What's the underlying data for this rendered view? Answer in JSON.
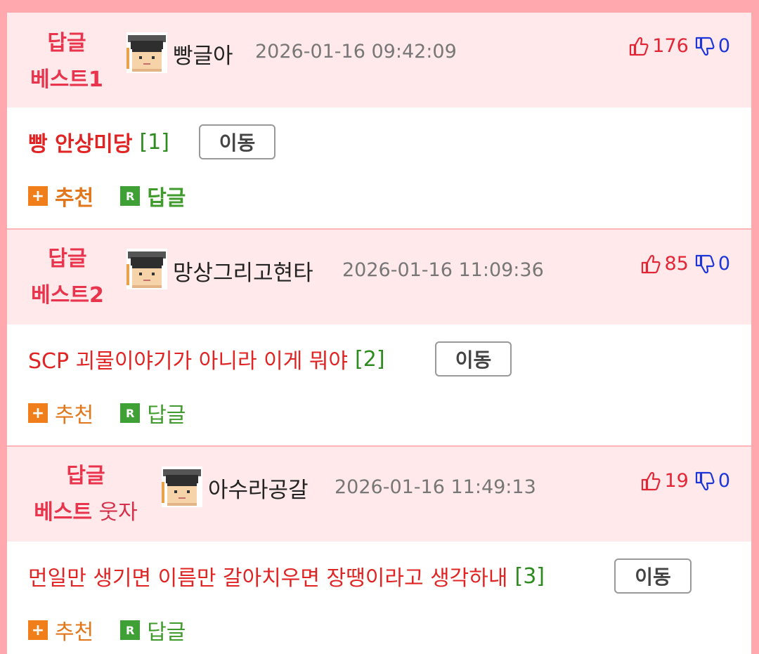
{
  "comments": [
    {
      "best_line1": "답글",
      "best_line2": "베스트1",
      "best_suffix": "",
      "nickname": "빵글아",
      "datetime": "2026-01-16 09:42:09",
      "likes": "176",
      "dislikes": "0",
      "title": "빵 안상미당",
      "reply_count": "[1]",
      "move_label": "이동",
      "recommend_label": "추천",
      "reply_label": "답글"
    },
    {
      "best_line1": "답글",
      "best_line2": "베스트2",
      "best_suffix": "",
      "nickname": "망상그리고현타",
      "datetime": "2026-01-16 11:09:36",
      "likes": "85",
      "dislikes": "0",
      "title": "SCP 괴물이야기가 아니라 이게 뭐야",
      "reply_count": "[2]",
      "move_label": "이동",
      "recommend_label": "추천",
      "reply_label": "답글"
    },
    {
      "best_line1": "답글",
      "best_line2": "베스트",
      "best_suffix": " 웃자",
      "nickname": "아수라공갈",
      "datetime": "2026-01-16 11:49:13",
      "likes": "19",
      "dislikes": "0",
      "title": "먼일만 생기면 이름만 갈아치우면 장땡이라고 생각하내",
      "reply_count": "[3]",
      "move_label": "이동",
      "recommend_label": "추천",
      "reply_label": "답글"
    }
  ],
  "icons": {
    "avatar": "graduate-avatar-icon",
    "thumb_up": "thumbs-up-icon",
    "thumb_down": "thumbs-down-icon",
    "plus": "plus-box-icon",
    "reply": "r-box-icon"
  },
  "colors": {
    "border": "#ffa8ad",
    "header_bg": "#ffe9ea",
    "best_red": "#e8344c",
    "title_red": "#e02424",
    "count_green": "#2e8b1f",
    "like_red": "#e32636",
    "dislike_blue": "#1d36d8",
    "recommend_orange": "#e2761a",
    "reply_green": "#3f9c2c"
  }
}
